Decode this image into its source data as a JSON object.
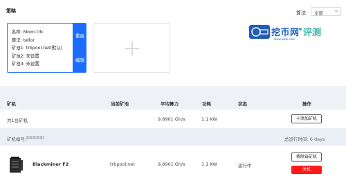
{
  "strategy": {
    "section_title": "策略",
    "algorithm_label": "算法:",
    "algorithm_selected": "全部",
    "card": {
      "name": "名称: Moon.trb",
      "algorithm": "算法: tellor",
      "pool1": "矿池1: trbpool.net(默认)",
      "pool2": "矿池2: 未设置",
      "pool3": "矿池3: 未设置",
      "apply_label": "重启",
      "edit_label": "编辑"
    },
    "add_icon": "plus-icon"
  },
  "watermark": {
    "brand": "挖币网",
    "review": "评测",
    "domain": "www.wabi.com"
  },
  "table": {
    "headers": {
      "miner": "矿机",
      "current_pool": "当前矿池",
      "avg_hashrate": "平均算力",
      "power": "功耗",
      "status": "状态",
      "actions": "操作"
    },
    "summary": {
      "count_text": "共1台矿机",
      "hashrate": "9.8901 Gh/s",
      "power": "1.1 KW",
      "add_miner_label": "十添加矿机"
    },
    "device_group": {
      "id_label": "矿机编号:",
      "uptime": "总运行时间: 6 days"
    },
    "devices": [
      {
        "model": "Blackminer F2",
        "pool": "trbpool.net",
        "hashrate": "9.8901 Gh/s",
        "power": "1.1 KW",
        "status": "运行中",
        "remove_label": "移除该矿机",
        "shutdown_label": "关机"
      }
    ]
  },
  "colors": {
    "accent": "#1a6dff",
    "danger": "#ff1a1a",
    "page_bg": "#eef1f6"
  }
}
